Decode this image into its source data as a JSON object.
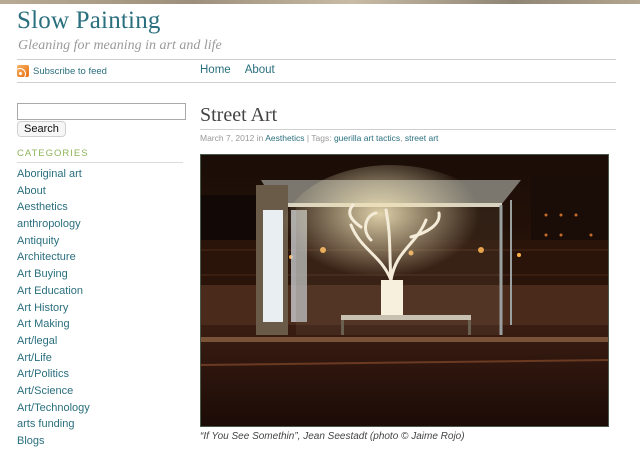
{
  "site": {
    "title": "Slow Painting",
    "tagline": "Gleaning for meaning in art and life",
    "subscribe_label": "Subscribe to feed"
  },
  "nav": {
    "items": [
      "Home",
      "About"
    ]
  },
  "search": {
    "button_label": "Search",
    "placeholder": ""
  },
  "sidebar": {
    "categories_heading": "CATEGORIES",
    "categories": [
      "Aboriginal art",
      "About",
      "Aesthetics",
      "anthropology",
      "Antiquity",
      "Architecture",
      "Art Buying",
      "Art Education",
      "Art History",
      "Art Making",
      "Art/legal",
      "Art/Life",
      "Art/Politics",
      "Art/Science",
      "Art/Technology",
      "arts funding",
      "Blogs"
    ]
  },
  "post": {
    "title": "Street Art",
    "date": "March 7, 2012",
    "in_text": "in",
    "category": "Aesthetics",
    "tags_label": "| Tags:",
    "tags": [
      "guerilla art tactics",
      "street art"
    ],
    "tag_separator": ",",
    "image": {
      "caption": "“If You See Somethin”, Jean Seestadt (photo © Jaime Rojo)"
    }
  },
  "colors": {
    "link": "#2a6f7e",
    "category_heading": "#8db45a",
    "muted": "#999999"
  }
}
